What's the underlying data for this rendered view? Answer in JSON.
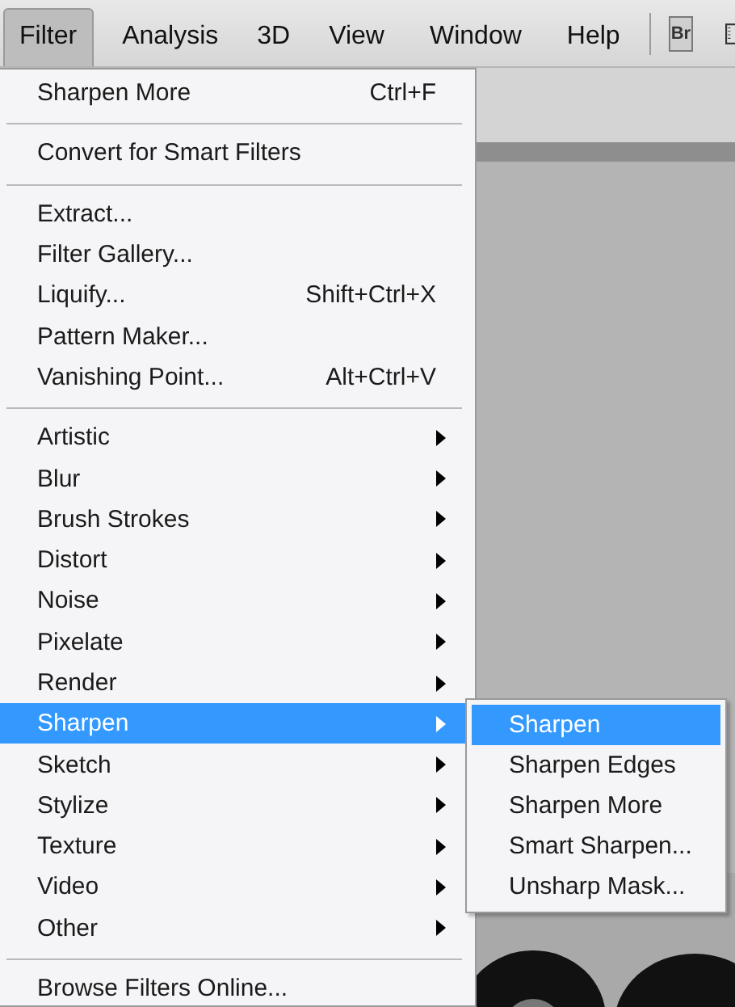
{
  "menu_bar": [
    {
      "label": "Filter",
      "selected": true
    },
    {
      "label": "Analysis",
      "selected": false
    },
    {
      "label": "3D",
      "selected": false
    },
    {
      "label": "View",
      "selected": false
    },
    {
      "label": "Window",
      "selected": false
    },
    {
      "label": "Help",
      "selected": false
    }
  ],
  "bridge_button": "Br",
  "filter_menu": [
    [
      {
        "label": "Sharpen More",
        "shortcut": "Ctrl+F",
        "submenu": false,
        "selected": false
      }
    ],
    [
      {
        "label": "Convert for Smart Filters",
        "submenu": false,
        "selected": false
      }
    ],
    [
      {
        "label": "Extract...",
        "submenu": false,
        "selected": false
      },
      {
        "label": "Filter Gallery...",
        "submenu": false,
        "selected": false
      },
      {
        "label": "Liquify...",
        "shortcut": "Shift+Ctrl+X",
        "submenu": false,
        "selected": false
      },
      {
        "label": "Pattern Maker...",
        "submenu": false,
        "selected": false
      },
      {
        "label": "Vanishing Point...",
        "shortcut": "Alt+Ctrl+V",
        "submenu": false,
        "selected": false
      }
    ],
    [
      {
        "label": "Artistic",
        "submenu": true,
        "selected": false
      },
      {
        "label": "Blur",
        "submenu": true,
        "selected": false
      },
      {
        "label": "Brush Strokes",
        "submenu": true,
        "selected": false
      },
      {
        "label": "Distort",
        "submenu": true,
        "selected": false
      },
      {
        "label": "Noise",
        "submenu": true,
        "selected": false
      },
      {
        "label": "Pixelate",
        "submenu": true,
        "selected": false
      },
      {
        "label": "Render",
        "submenu": true,
        "selected": false
      },
      {
        "label": "Sharpen",
        "submenu": true,
        "selected": true
      },
      {
        "label": "Sketch",
        "submenu": true,
        "selected": false
      },
      {
        "label": "Stylize",
        "submenu": true,
        "selected": false
      },
      {
        "label": "Texture",
        "submenu": true,
        "selected": false
      },
      {
        "label": "Video",
        "submenu": true,
        "selected": false
      },
      {
        "label": "Other",
        "submenu": true,
        "selected": false
      }
    ],
    [
      {
        "label": "Browse Filters Online...",
        "submenu": false,
        "selected": false
      }
    ]
  ],
  "sharpen_submenu": [
    {
      "label": "Sharpen",
      "selected": true
    },
    {
      "label": "Sharpen Edges",
      "selected": false
    },
    {
      "label": "Sharpen More",
      "selected": false
    },
    {
      "label": "Smart Sharpen...",
      "selected": false
    },
    {
      "label": "Unsharp Mask...",
      "selected": false
    }
  ]
}
